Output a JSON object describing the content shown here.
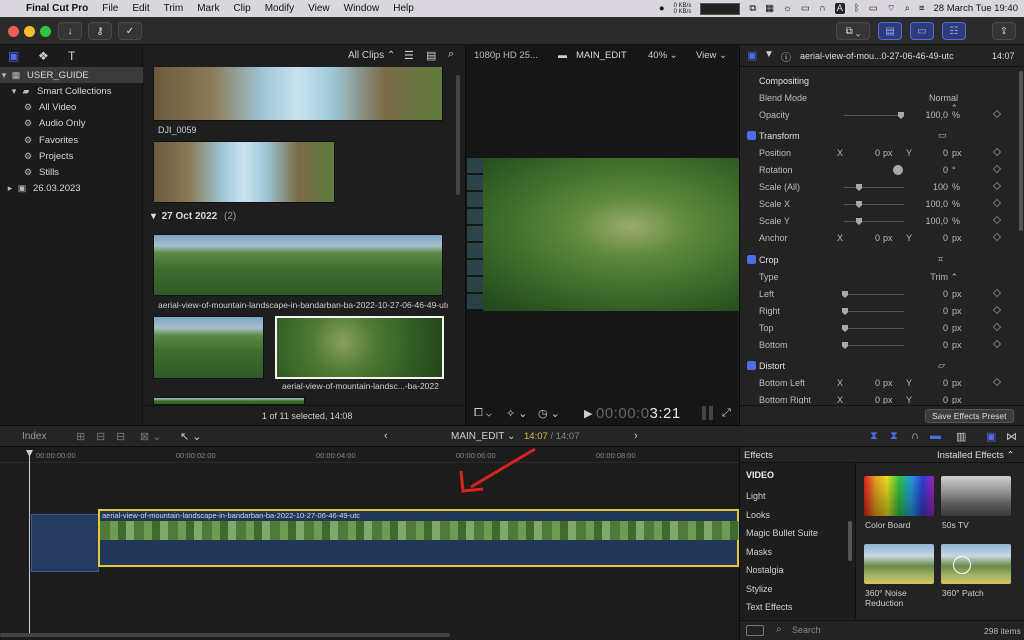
{
  "menubar": {
    "app": "Final Cut Pro",
    "items": [
      "File",
      "Edit",
      "Trim",
      "Mark",
      "Clip",
      "Modify",
      "View",
      "Window",
      "Help"
    ],
    "net_up": "0 KB/s",
    "net_down": "0 KB/s",
    "clock": "28 March Tue  19:40"
  },
  "browser": {
    "filter": "All Clips",
    "clip1_name": "DJI_0059",
    "date_header": "27 Oct 2022",
    "date_count": "(2)",
    "clip3_name": "aerial-view-of-mountain-landscape-in-bandarban-ba-2022-10-27-06-46-49-utc",
    "clip4_name": "aerial-view-of-mountain-landsc...-ba-2022",
    "status": "1 of 11 selected, 14:08"
  },
  "sidebar": {
    "library": "USER_GUIDE",
    "items": [
      "Smart Collections",
      "All Video",
      "Audio Only",
      "Favorites",
      "Projects",
      "Stills",
      "26.03.2023"
    ]
  },
  "viewer": {
    "format": "1080p HD 25...",
    "project": "MAIN_EDIT",
    "zoom": "40%",
    "view_menu": "View",
    "timecode": "00:00:03:21",
    "timecode_dim": "00:00:0",
    "timecode_bright": "3:21"
  },
  "inspector": {
    "clip_title": "aerial-view-of-mou...0-27-06-46-49-utc",
    "duration": "14:07",
    "compositing": "Compositing",
    "blend_mode_label": "Blend Mode",
    "blend_mode_value": "Normal",
    "opacity_label": "Opacity",
    "opacity_value": "100,0",
    "transform": "Transform",
    "position_label": "Position",
    "position_x": "0",
    "position_y": "0",
    "rotation_label": "Rotation",
    "rotation_value": "0",
    "scale_all_label": "Scale (All)",
    "scale_all_value": "100",
    "scale_x_label": "Scale X",
    "scale_x_value": "100,0",
    "scale_y_label": "Scale Y",
    "scale_y_value": "100,0",
    "anchor_label": "Anchor",
    "anchor_x": "0",
    "anchor_y": "0",
    "crop": "Crop",
    "type_label": "Type",
    "type_value": "Trim",
    "left_label": "Left",
    "right_label": "Right",
    "top_label": "Top",
    "bottom_label": "Bottom",
    "crop_value": "0",
    "distort": "Distort",
    "bottom_left_label": "Bottom Left",
    "bottom_right_label": "Bottom Right",
    "save_preset": "Save Effects Preset",
    "unit_px": "px",
    "unit_pct": "%",
    "unit_deg": "°",
    "x": "X",
    "y": "Y"
  },
  "timeline": {
    "index": "Index",
    "project": "MAIN_EDIT",
    "position": "14:07",
    "total": "/ 14:07",
    "ruler": [
      "00:00:00:00",
      "00:00:02:00",
      "00:00:04:00",
      "00:00:06:00",
      "00:00:08:00"
    ],
    "clip_name": "aerial-view-of-mountain-landscape-in-bandarban-ba-2022-10-27-06-46-49-utc"
  },
  "effects": {
    "title": "Effects",
    "installed": "Installed Effects",
    "categories": [
      "VIDEO",
      "Light",
      "Looks",
      "Magic Bullet Suite",
      "Masks",
      "Nostalgia",
      "Stylize",
      "Text Effects"
    ],
    "items": [
      "Color Board",
      "50s TV",
      "360° Noise Reduction",
      "360° Patch"
    ],
    "search_placeholder": "Search",
    "count": "298 items"
  },
  "colors": {
    "accent": "#4e6ee8",
    "timecode_yellow": "#e0b84a",
    "clip_border": "#e3c93a",
    "arrow_red": "#d8231c"
  }
}
